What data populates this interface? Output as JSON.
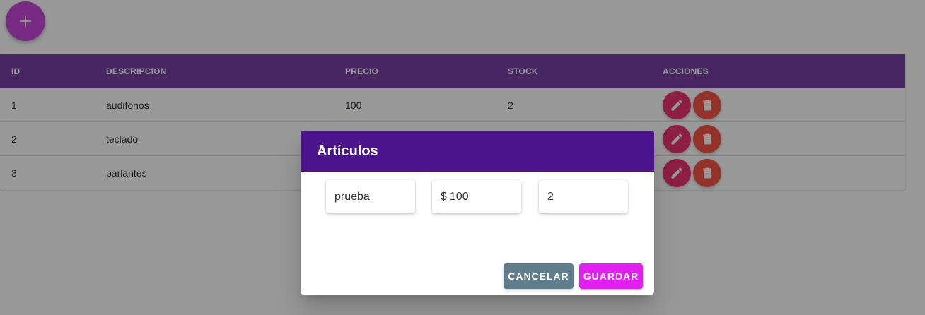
{
  "fab": {
    "icon": "plus-icon"
  },
  "table": {
    "columns": [
      "ID",
      "DESCRIPCION",
      "PRECIO",
      "STOCK",
      "ACCIONES"
    ],
    "rows": [
      {
        "id": "1",
        "descripcion": "audifonos",
        "precio": "100",
        "stock": "2"
      },
      {
        "id": "2",
        "descripcion": "teclado",
        "precio": "",
        "stock": ""
      },
      {
        "id": "3",
        "descripcion": "parlantes",
        "precio": "",
        "stock": ""
      }
    ],
    "action_icons": [
      "pencil-icon",
      "trash-icon"
    ]
  },
  "dialog": {
    "title": "Artículos",
    "fields": {
      "descripcion": "prueba",
      "precio_prefix": "$",
      "precio": "100",
      "stock": "2"
    },
    "cancel_label": "CANCELAR",
    "save_label": "GUARDAR"
  },
  "colors": {
    "header": "#6a2c9c",
    "dialog_header": "#4a148c",
    "fab": "#c034d6",
    "edit": "#e91e63",
    "delete": "#f44336",
    "cancel": "#607d8b",
    "save": "#e01ff0"
  }
}
